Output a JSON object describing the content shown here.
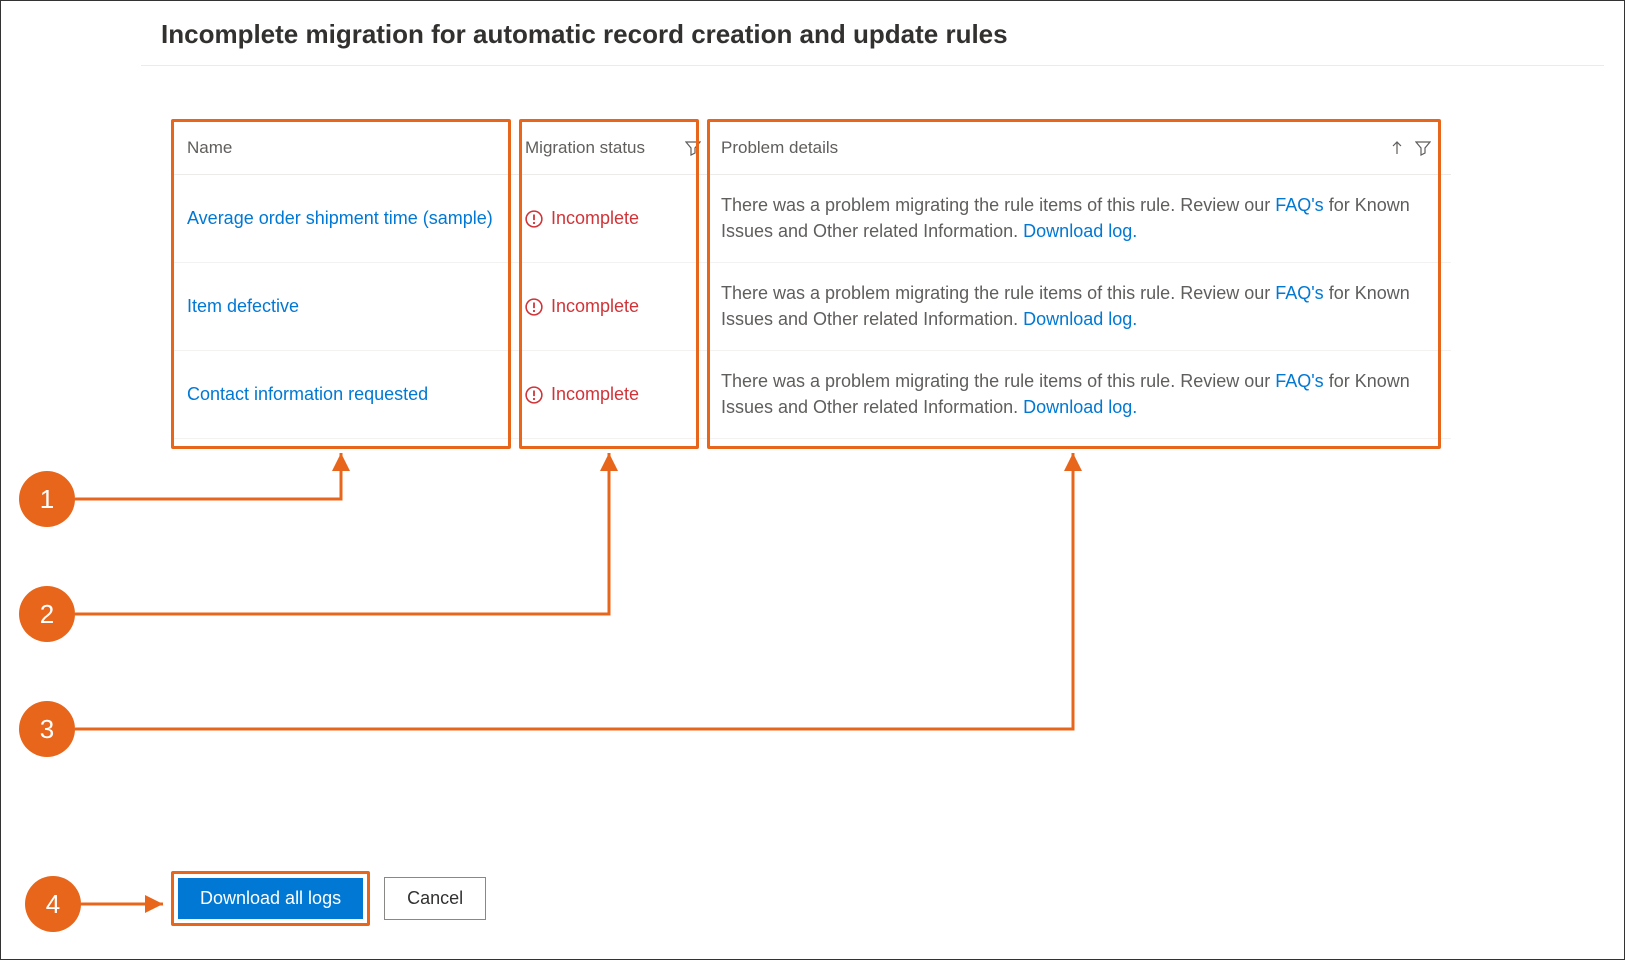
{
  "page": {
    "title": "Incomplete migration for automatic record creation and update rules"
  },
  "table": {
    "columns": {
      "name": "Name",
      "status": "Migration status",
      "details": "Problem details"
    },
    "rows": [
      {
        "name": "Average order shipment time (sample)",
        "status": "Incomplete",
        "detail_prefix": "There was a problem migrating the rule items of this rule. Review our ",
        "faq_link": "FAQ's",
        "detail_mid": " for Known Issues and Other related Information. ",
        "download_link": "Download log."
      },
      {
        "name": "Item defective",
        "status": "Incomplete",
        "detail_prefix": "There was a problem migrating the rule items of this rule. Review our ",
        "faq_link": "FAQ's",
        "detail_mid": " for Known Issues and Other related Information. ",
        "download_link": "Download log."
      },
      {
        "name": "Contact information requested",
        "status": "Incomplete",
        "detail_prefix": "There was a problem migrating the rule items of this rule. Review our ",
        "faq_link": "FAQ's",
        "detail_mid": " for Known Issues and Other related Information. ",
        "download_link": "Download log."
      }
    ]
  },
  "callouts": {
    "b1": "1",
    "b2": "2",
    "b3": "3",
    "b4": "4"
  },
  "footer": {
    "primary": "Download all logs",
    "secondary": "Cancel"
  }
}
